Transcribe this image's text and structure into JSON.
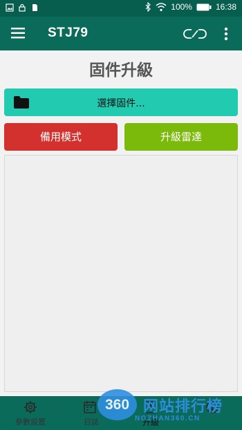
{
  "status_bar": {
    "battery": "100%",
    "time": "16:38"
  },
  "app_bar": {
    "title": "STJ79",
    "menu_icon": "hamburger-menu-icon",
    "link_icon": "link-icon",
    "more_icon": "more-vert-icon"
  },
  "main": {
    "page_title": "固件升級",
    "select_firmware_label": "選擇固件...",
    "backup_mode_label": "備用模式",
    "upgrade_radar_label": "升級雷達"
  },
  "bottom_nav": {
    "items": [
      {
        "label": "參數設置",
        "icon": "gear-icon"
      },
      {
        "label": "日誌",
        "icon": "calendar-icon"
      },
      {
        "label": "升級",
        "icon": "upgrade-icon"
      },
      {
        "label": "",
        "icon": "info-icon"
      }
    ]
  },
  "watermark": {
    "logo_text": "360",
    "brand_text": "网站排行榜",
    "url_text": "NGZHAN360.CN"
  },
  "colors": {
    "status_bar": "#075e4f",
    "app_bar": "#0b6b5a",
    "select_button": "#22cbb0",
    "backup_button": "#d3312d",
    "upgrade_button": "#7bba0a",
    "watermark": "#2f8fe0"
  }
}
